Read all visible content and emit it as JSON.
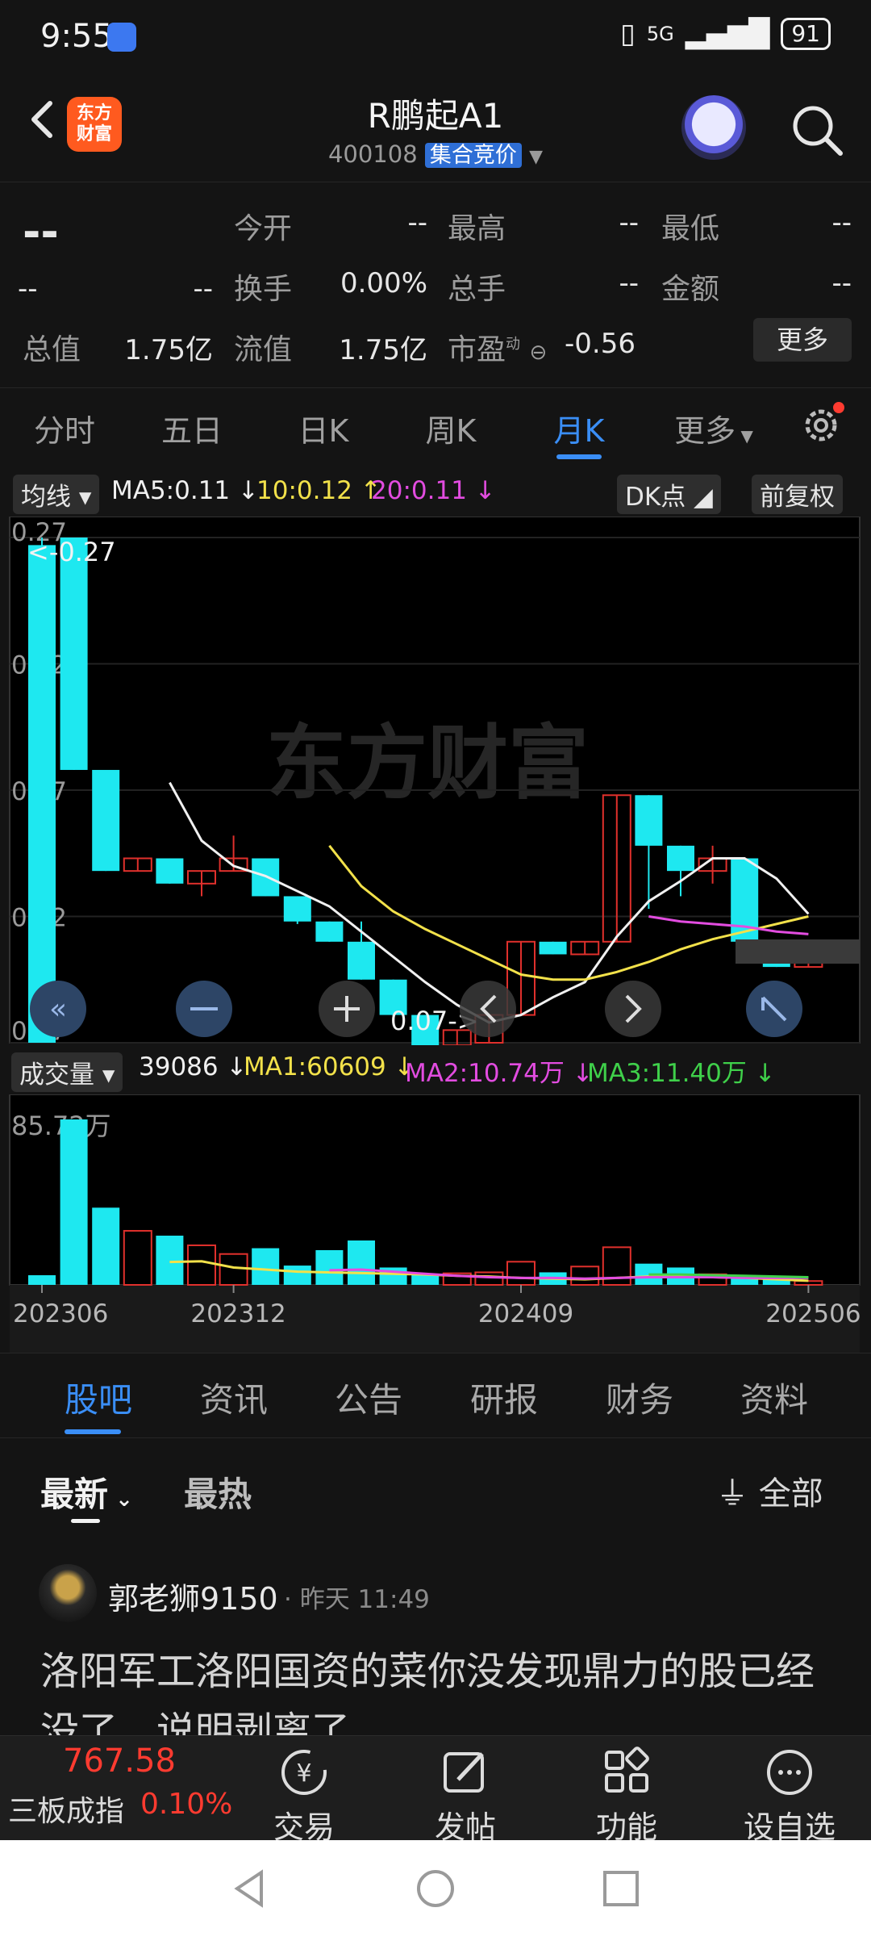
{
  "status": {
    "time": "9:55",
    "network": "5G",
    "battery": "91"
  },
  "header": {
    "stock_name": "R鹏起A1",
    "stock_code": "400108",
    "auction_label": "集合竞价",
    "logo_line1": "东方",
    "logo_line2": "财富"
  },
  "quote": {
    "price": "--",
    "change": "--",
    "change_pct": "--",
    "open_label": "今开",
    "open": "--",
    "high_label": "最高",
    "high": "--",
    "low_label": "最低",
    "low": "--",
    "turnover_label": "换手",
    "turnover": "0.00%",
    "volume_label": "总手",
    "volume": "--",
    "amount_label": "金额",
    "amount": "--",
    "total_mv_label": "总值",
    "total_mv": "1.75亿",
    "float_mv_label": "流值",
    "float_mv": "1.75亿",
    "pe_label": "市盈",
    "pe_sup": "动",
    "pe": "-0.56",
    "more_label": "更多"
  },
  "chart_tabs": [
    "分时",
    "五日",
    "日K",
    "周K",
    "月K",
    "更多"
  ],
  "active_chart_tab": 4,
  "ma_legend": {
    "pill": "均线",
    "ma5": "MA5:0.11",
    "ma10": "10:0.12",
    "ma20": "20:0.11",
    "dk": "DK点",
    "fq": "前复权"
  },
  "vol_legend": {
    "pill": "成交量",
    "vol": "39086",
    "ma1": "MA1:60609",
    "ma2": "MA2:10.74万",
    "ma3": "MA3:11.40万"
  },
  "watermark": "东方财富",
  "chart_data": {
    "type": "candlestick",
    "y_ticks": [
      "0.27",
      "0.22",
      "0.17",
      "0.12",
      "0.07"
    ],
    "ylim": [
      0.07,
      0.27
    ],
    "high_marker": "<-0.27",
    "low_marker": "0.07->",
    "x_ticks": [
      {
        "label": "202306",
        "index": 0
      },
      {
        "label": "202312",
        "index": 6
      },
      {
        "label": "202409",
        "index": 15
      },
      {
        "label": "202506",
        "index": 24
      }
    ],
    "candles": [
      {
        "o": 0.267,
        "c": 0.07,
        "h": 0.27,
        "l": 0.07,
        "v": 50000
      },
      {
        "o": 0.27,
        "c": 0.178,
        "h": 0.27,
        "l": 0.178,
        "v": 857200
      },
      {
        "o": 0.178,
        "c": 0.138,
        "h": 0.178,
        "l": 0.138,
        "v": 400000
      },
      {
        "o": 0.138,
        "c": 0.143,
        "h": 0.143,
        "l": 0.138,
        "v": 280000
      },
      {
        "o": 0.143,
        "c": 0.133,
        "h": 0.143,
        "l": 0.133,
        "v": 255000
      },
      {
        "o": 0.133,
        "c": 0.138,
        "h": 0.138,
        "l": 0.128,
        "v": 205000
      },
      {
        "o": 0.138,
        "c": 0.143,
        "h": 0.152,
        "l": 0.138,
        "v": 160000
      },
      {
        "o": 0.143,
        "c": 0.128,
        "h": 0.143,
        "l": 0.128,
        "v": 190000
      },
      {
        "o": 0.128,
        "c": 0.118,
        "h": 0.128,
        "l": 0.117,
        "v": 100000
      },
      {
        "o": 0.118,
        "c": 0.11,
        "h": 0.118,
        "l": 0.11,
        "v": 180000
      },
      {
        "o": 0.11,
        "c": 0.095,
        "h": 0.118,
        "l": 0.095,
        "v": 230000
      },
      {
        "o": 0.095,
        "c": 0.081,
        "h": 0.095,
        "l": 0.08,
        "v": 90000
      },
      {
        "o": 0.081,
        "c": 0.069,
        "h": 0.081,
        "l": 0.069,
        "v": 55000
      },
      {
        "o": 0.069,
        "c": 0.075,
        "h": 0.075,
        "l": 0.069,
        "v": 60000
      },
      {
        "o": 0.07,
        "c": 0.081,
        "h": 0.081,
        "l": 0.07,
        "v": 65000
      },
      {
        "o": 0.081,
        "c": 0.11,
        "h": 0.11,
        "l": 0.081,
        "v": 120000
      },
      {
        "o": 0.11,
        "c": 0.105,
        "h": 0.11,
        "l": 0.105,
        "v": 65000
      },
      {
        "o": 0.105,
        "c": 0.11,
        "h": 0.11,
        "l": 0.105,
        "v": 95000
      },
      {
        "o": 0.11,
        "c": 0.168,
        "h": 0.168,
        "l": 0.11,
        "v": 195000
      },
      {
        "o": 0.168,
        "c": 0.148,
        "h": 0.168,
        "l": 0.123,
        "v": 110000
      },
      {
        "o": 0.148,
        "c": 0.138,
        "h": 0.148,
        "l": 0.128,
        "v": 90000
      },
      {
        "o": 0.138,
        "c": 0.143,
        "h": 0.148,
        "l": 0.133,
        "v": 55000
      },
      {
        "o": 0.143,
        "c": 0.11,
        "h": 0.143,
        "l": 0.108,
        "v": 40000
      },
      {
        "o": 0.11,
        "c": 0.1,
        "h": 0.11,
        "l": 0.1,
        "v": 45000
      },
      {
        "o": 0.1,
        "c": 0.105,
        "h": 0.105,
        "l": 0.1,
        "v": 20000
      }
    ],
    "ma5": [
      null,
      null,
      null,
      null,
      0.173,
      0.15,
      0.14,
      0.136,
      0.13,
      0.124,
      0.114,
      0.104,
      0.094,
      0.085,
      0.078,
      0.081,
      0.088,
      0.094,
      0.112,
      0.126,
      0.134,
      0.143,
      0.143,
      0.135,
      0.121
    ],
    "ma10": [
      null,
      null,
      null,
      null,
      null,
      null,
      null,
      null,
      null,
      0.148,
      0.132,
      0.122,
      0.115,
      0.109,
      0.103,
      0.097,
      0.095,
      0.095,
      0.098,
      0.102,
      0.107,
      0.111,
      0.114,
      0.117,
      0.12
    ],
    "ma20": [
      null,
      null,
      null,
      null,
      null,
      null,
      null,
      null,
      null,
      null,
      null,
      null,
      null,
      null,
      null,
      null,
      null,
      null,
      null,
      0.12,
      0.118,
      0.117,
      0.116,
      0.114,
      0.113
    ],
    "vol_ma1": [
      null,
      null,
      null,
      null,
      0.33,
      0.34,
      0.25,
      0.22,
      0.19,
      0.18,
      0.17,
      0.16,
      0.15,
      0.13,
      0.12,
      0.1,
      0.09,
      0.08,
      0.1,
      0.12,
      0.12,
      0.11,
      0.1,
      0.08,
      0.06
    ],
    "vol_ma2": [
      null,
      null,
      null,
      null,
      null,
      null,
      null,
      null,
      null,
      0.21,
      0.22,
      0.19,
      0.16,
      0.13,
      0.11,
      0.1,
      0.1,
      0.09,
      0.1,
      0.11,
      0.11,
      0.11,
      0.1,
      0.1,
      0.1
    ],
    "vol_ma3": [
      null,
      null,
      null,
      null,
      null,
      null,
      null,
      null,
      null,
      null,
      null,
      null,
      null,
      null,
      null,
      null,
      null,
      null,
      null,
      0.15,
      0.15,
      0.14,
      0.13,
      0.12,
      0.11
    ],
    "vol_max_label": "85.72万"
  },
  "guba_tabs": [
    "股吧",
    "资讯",
    "公告",
    "研报",
    "财务",
    "资料"
  ],
  "sort": {
    "latest": "最新",
    "hot": "最热",
    "filter": "全部"
  },
  "post": {
    "author": "郭老狮9150",
    "time": "· 昨天 11:49",
    "text": "洛阳军工洛阳国资的菜你没发现鼎力的股已经没了，说明剥离了"
  },
  "bottom": {
    "index_value": "767.58",
    "index_name": "三板成指",
    "index_pct": "0.10%",
    "trade": "交易",
    "post": "发帖",
    "function": "功能",
    "watchlist": "设自选"
  }
}
